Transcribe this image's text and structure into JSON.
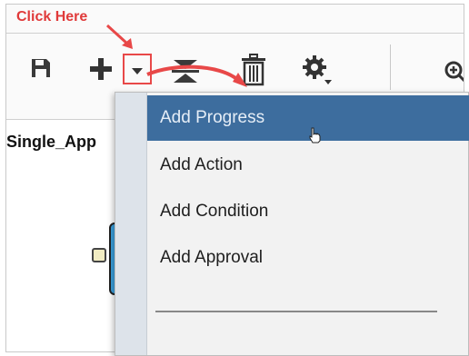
{
  "callout": {
    "text": "Click Here"
  },
  "toolbar": {
    "save": "save-icon",
    "add": "plus-icon",
    "dropdown": "chevron-down-icon",
    "collapse": "collapse-icon",
    "delete": "trash-icon",
    "settings": "gear-icon",
    "zoom": "zoom-in-icon"
  },
  "tab": {
    "label": "Single_App"
  },
  "menu": {
    "items": [
      {
        "label": "Add Progress",
        "highlighted": true
      },
      {
        "label": "Add Action"
      },
      {
        "label": "Add Condition"
      },
      {
        "label": "Add Approval"
      }
    ]
  },
  "colors": {
    "callout": "#e03a3a",
    "highlight": "#3d6d9e",
    "node": "#3aa0dd"
  }
}
